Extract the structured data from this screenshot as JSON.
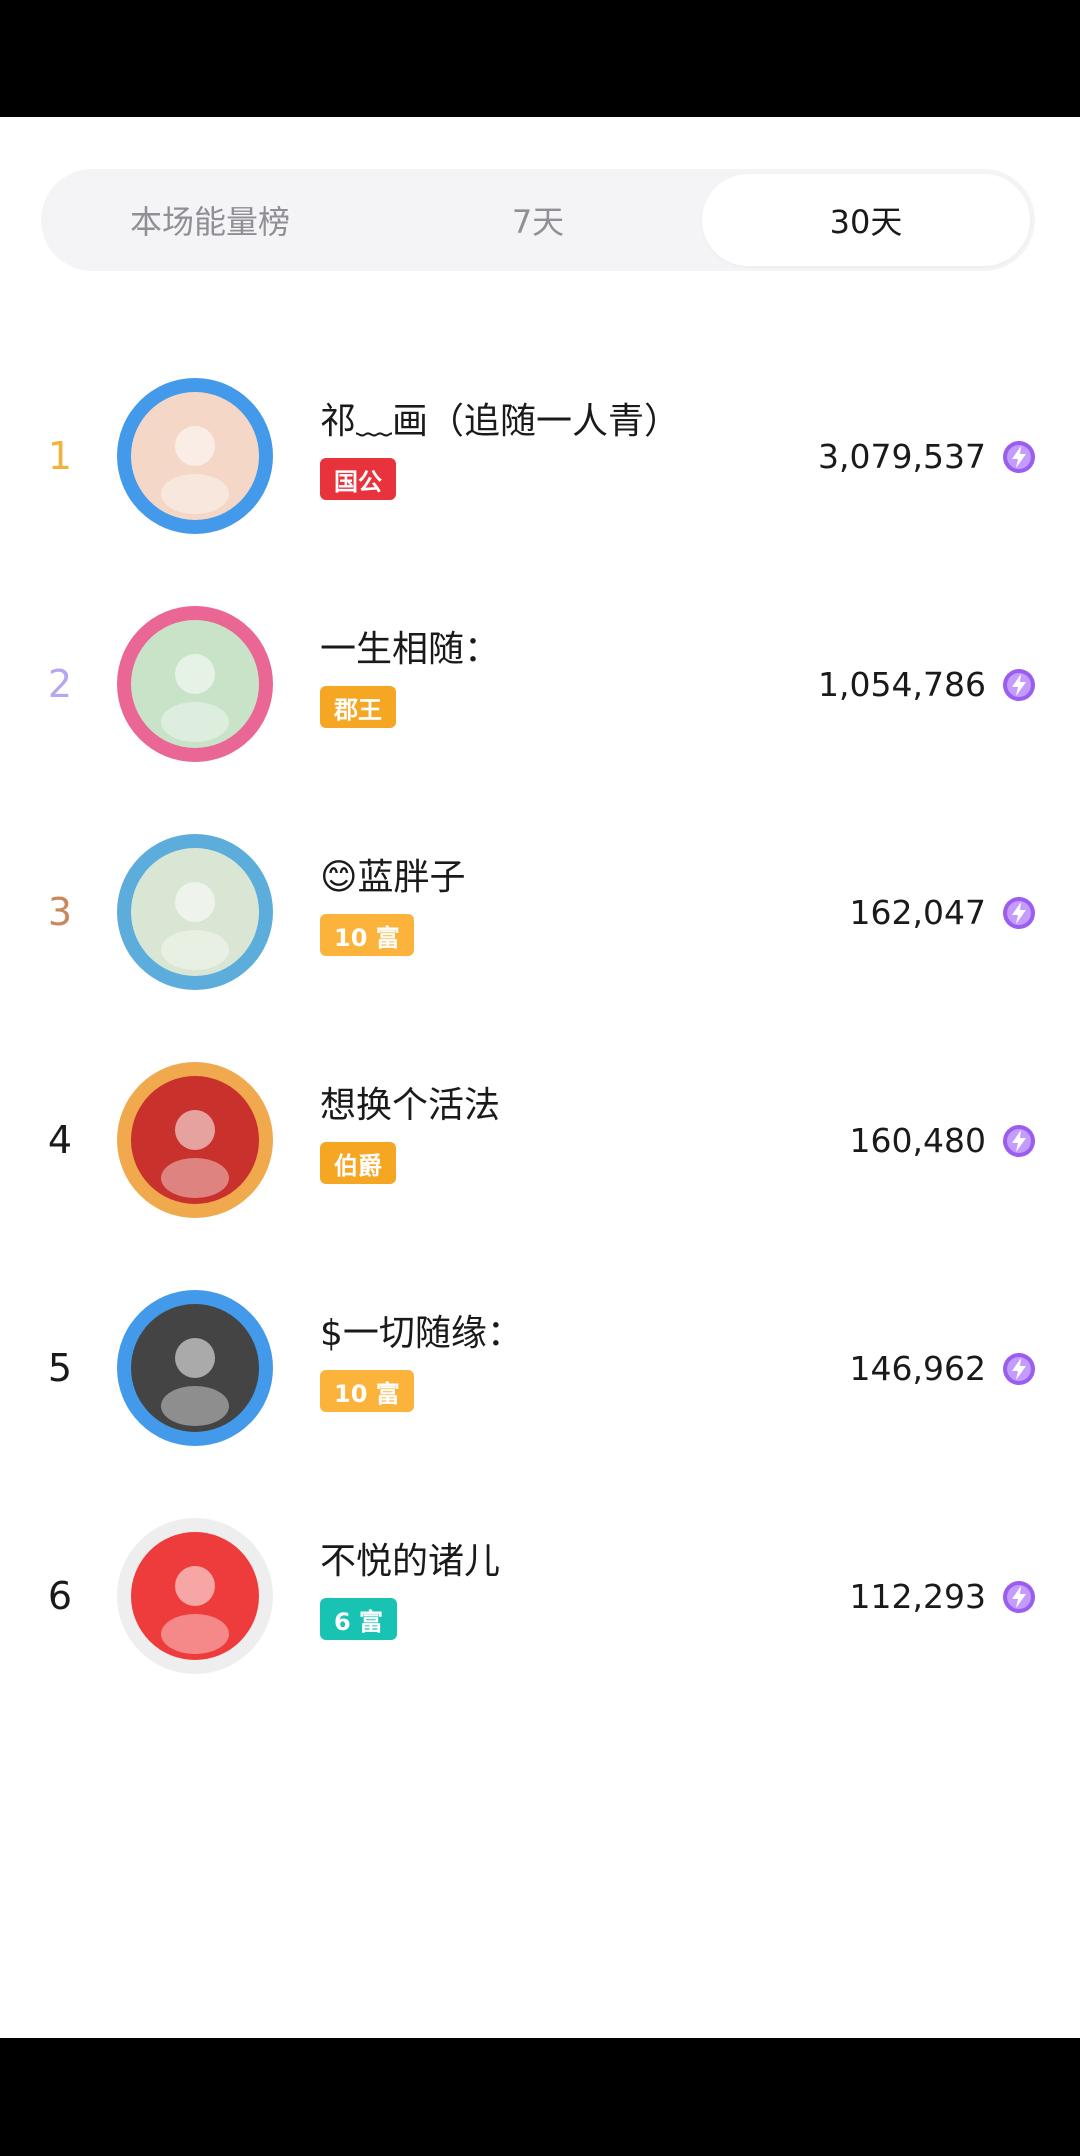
{
  "tabs": [
    {
      "label": "本场能量榜",
      "active": false
    },
    {
      "label": "7天",
      "active": false
    },
    {
      "label": "30天",
      "active": true
    }
  ],
  "rows": [
    {
      "rank": "1",
      "name": "祁﹏画（追随一人青）",
      "badge": "国公",
      "score": "3,079,537",
      "rank_color": "#f2b33d",
      "badge_color": "#e8323c",
      "avatar_colors": [
        "#2f8fe8",
        "#f4d7c7"
      ]
    },
    {
      "rank": "2",
      "name": "一生相随：",
      "badge": "郡王",
      "score": "1,054,786",
      "rank_color": "#b9a6f0",
      "badge_color": "#f5a623",
      "avatar_colors": [
        "#e8558a",
        "#c8e3c8"
      ]
    },
    {
      "rank": "3",
      "name": "😊蓝胖子",
      "badge": "10 富",
      "score": "162,047",
      "rank_color": "#c9885a",
      "badge_color": "#fbb33b",
      "avatar_colors": [
        "#4aa3d8",
        "#d9e6d3"
      ]
    },
    {
      "rank": "4",
      "name": "想换个活法",
      "badge": "伯爵",
      "score": "160,480",
      "rank_color": "#1a1a1a",
      "badge_color": "#f5a623",
      "avatar_colors": [
        "#f0a03a",
        "#c8312c"
      ]
    },
    {
      "rank": "5",
      "name": "$一切随缘：",
      "badge": "10 富",
      "score": "146,962",
      "rank_color": "#1a1a1a",
      "badge_color": "#fbb33b",
      "avatar_colors": [
        "#2f8fe8",
        "#444444"
      ]
    },
    {
      "rank": "6",
      "name": "不悦的诸儿",
      "badge": "6 富",
      "score": "112,293",
      "rank_color": "#1a1a1a",
      "badge_color": "#19c3b4",
      "avatar_colors": [
        "#ececec",
        "#ee3b3b"
      ]
    }
  ]
}
